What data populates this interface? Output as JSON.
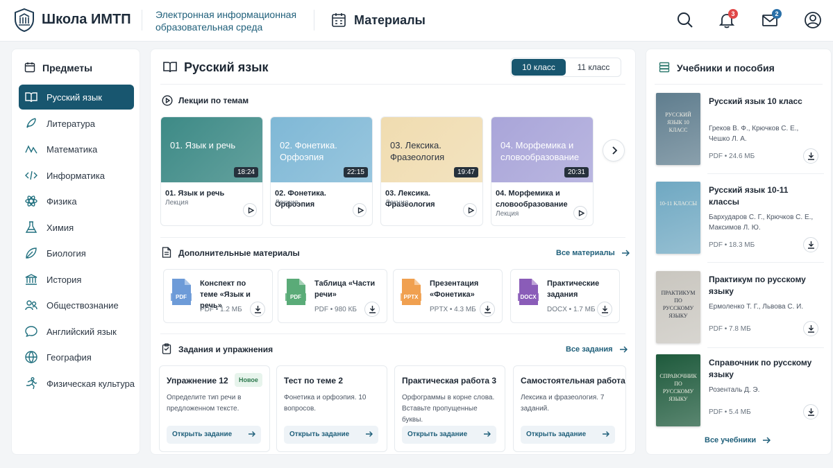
{
  "header": {
    "school_name": "Школа ИМТП",
    "env_line1": "Электронная информационная",
    "env_line2": "образовательная среда",
    "section": "Материалы",
    "notifications_count": "3",
    "messages_count": "2"
  },
  "sidebar": {
    "title": "Предметы",
    "items": [
      {
        "label": "Русский язык",
        "icon": "book-open-icon"
      },
      {
        "label": "Литература",
        "icon": "feather-icon"
      },
      {
        "label": "Математика",
        "icon": "function-icon"
      },
      {
        "label": "Информатика",
        "icon": "code-icon"
      },
      {
        "label": "Физика",
        "icon": "atom-icon"
      },
      {
        "label": "Химия",
        "icon": "flask-icon"
      },
      {
        "label": "Биология",
        "icon": "leaf-icon"
      },
      {
        "label": "История",
        "icon": "columns-icon"
      },
      {
        "label": "Обществознание",
        "icon": "people-icon"
      },
      {
        "label": "Английский язык",
        "icon": "chat-icon"
      },
      {
        "label": "География",
        "icon": "globe-icon"
      },
      {
        "label": "Физическая культура",
        "icon": "runner-icon"
      }
    ]
  },
  "main": {
    "subject": "Русский язык",
    "grades": [
      "10 класс",
      "11 класс"
    ],
    "lectures_title": "Лекции по темам",
    "lectures": [
      {
        "thumb": "01. Язык и речь",
        "duration": "18:24",
        "name": "01. Язык и речь",
        "type": "Лекция",
        "color": "#3d8a86"
      },
      {
        "thumb": "02. Фонетика. Орфоэпия",
        "duration": "22:15",
        "name": "02. Фонетика. Орфоэпия",
        "type": "Лекция",
        "color": "#7fb8d6"
      },
      {
        "thumb": "03. Лексика. Фразеология",
        "duration": "19:47",
        "name": "03. Лексика. Фразеология",
        "type": "Лекция",
        "color": "#f0dcb0"
      },
      {
        "thumb": "04. Морфемика и словообразование",
        "duration": "20:31",
        "name": "04. Морфемика и словообразование",
        "type": "Лекция",
        "color": "#a9a5d9"
      }
    ],
    "extra_title": "Дополнительные материалы",
    "extra_link": "Все материалы",
    "files": [
      {
        "name": "Конспект по теме «Язык и речь»",
        "ext": "PDF",
        "meta": "PDF • 1.2 МБ",
        "color": "#6d9bd8"
      },
      {
        "name": "Таблица «Части речи»",
        "ext": "PDF",
        "meta": "PDF • 980 КБ",
        "color": "#5aab78"
      },
      {
        "name": "Презентация «Фонетика»",
        "ext": "PPTX",
        "meta": "PPTX • 4.3 МБ",
        "color": "#f0a050"
      },
      {
        "name": "Практические задания",
        "ext": "DOCX",
        "meta": "DOCX • 1.7 МБ",
        "color": "#8a5cb8"
      }
    ],
    "tasks_title": "Задания и упражнения",
    "tasks_link": "Все задания",
    "tasks": [
      {
        "name": "Упражнение 12",
        "badge": "Новое",
        "desc": "Определите тип речи в предложенном тексте.",
        "button": "Открыть задание"
      },
      {
        "name": "Тест по теме 2",
        "desc": "Фонетика и орфоэпия. 10 вопросов.",
        "button": "Открыть задание"
      },
      {
        "name": "Практическая работа 3",
        "desc": "Орфограммы в корне слова. Вставьте пропущенные буквы.",
        "button": "Открыть задание"
      },
      {
        "name": "Самостоятельная работа",
        "desc": "Лексика и фразеология. 7 заданий.",
        "button": "Открыть задание"
      }
    ]
  },
  "textbooks": {
    "title": "Учебники и пособия",
    "items": [
      {
        "title": "Русский язык 10 класс",
        "authors": "Греков В. Ф., Крючков С. Е., Чешко Л. А.",
        "meta": "PDF • 24.6 МБ",
        "cover_text": "РУССКИЙ ЯЗЫК 10 КЛАСС",
        "cover_color": "#5f7d8e"
      },
      {
        "title": "Русский язык 10-11 классы",
        "authors": "Бархударов С. Г., Крючков С. Е., Максимов Л. Ю.",
        "meta": "PDF • 18.3 МБ",
        "cover_text": "10-11 КЛАССЫ",
        "cover_color": "#6fa8c2"
      },
      {
        "title": "Практикум по русскому языку",
        "authors": "Ермоленко Т. Г., Львова С. И.",
        "meta": "PDF • 7.8 МБ",
        "cover_text": "ПРАКТИКУМ ПО РУССКОМУ ЯЗЫКУ",
        "cover_color": "#c9c6bf"
      },
      {
        "title": "Справочник по русскому языку",
        "authors": "Розенталь Д. Э.",
        "meta": "PDF • 5.4 МБ",
        "cover_text": "СПРАВОЧНИК ПО РУССКОМУ ЯЗЫКУ",
        "cover_color": "#1e5a3c"
      }
    ],
    "all_link": "Все учебники"
  },
  "colors": {
    "accent": "#18566f",
    "badge": "#e04848",
    "link": "#1f5f7a"
  }
}
